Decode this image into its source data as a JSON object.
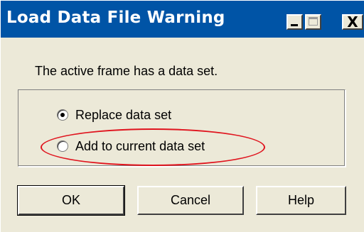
{
  "window": {
    "title": "Load Data File Warning",
    "controls": {
      "minimize_icon": "minimize-icon",
      "maximize_icon": "maximize-icon",
      "close_icon": "close-icon",
      "close_glyph": "X"
    }
  },
  "message": "The active frame has a data set.",
  "options": [
    {
      "label": "Replace data set",
      "selected": true
    },
    {
      "label": "Add to current data set",
      "selected": false
    }
  ],
  "annotation": {
    "color": "#e0141e"
  },
  "buttons": {
    "ok": "OK",
    "cancel": "Cancel",
    "help": "Help"
  },
  "colors": {
    "titlebar": "#0054a6",
    "title_text": "#ffffff",
    "dialog_bg": "#ece9d8"
  }
}
